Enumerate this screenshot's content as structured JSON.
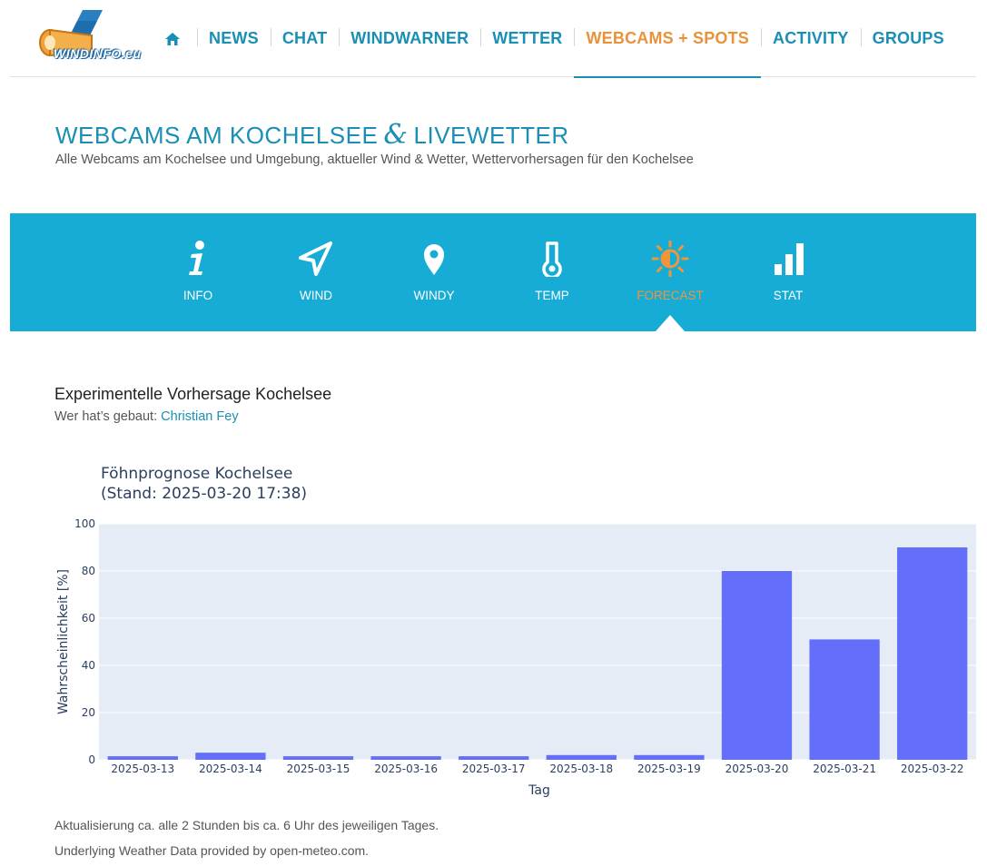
{
  "colors": {
    "brand": "#1a8fb5",
    "accent": "#e8923a",
    "band": "#17acd6",
    "bar": "#636efa",
    "plot_bg": "#e5ecf6"
  },
  "nav": {
    "home_icon": "home-icon",
    "items": [
      {
        "label": "NEWS"
      },
      {
        "label": "CHAT"
      },
      {
        "label": "WINDWARNER"
      },
      {
        "label": "WETTER"
      },
      {
        "label": "WEBCAMS + SPOTS",
        "active": true
      },
      {
        "label": "ACTIVITY"
      },
      {
        "label": "GROUPS"
      }
    ]
  },
  "logo": {
    "text": "WINDINFO.eu"
  },
  "title": {
    "part1": "WEBCAMS AM KOCHELSEE",
    "amp": "&",
    "part2": "LIVEWETTER"
  },
  "subtitle": "Alle Webcams am Kochelsee und Umgebung, aktueller Wind & Wetter, Wettervorhersagen für den Kochelsee",
  "tabs": [
    {
      "label": "INFO",
      "icon": "info-icon"
    },
    {
      "label": "WIND",
      "icon": "navigation-arrow-icon"
    },
    {
      "label": "WINDY",
      "icon": "map-pin-icon"
    },
    {
      "label": "TEMP",
      "icon": "thermometer-icon"
    },
    {
      "label": "FORECAST",
      "icon": "sun-icon",
      "active": true
    },
    {
      "label": "STAT",
      "icon": "bar-chart-icon"
    }
  ],
  "section": {
    "title": "Experimentelle Vorhersage Kochelsee",
    "credit_prefix": "Wer hat’s gebaut:",
    "credit_name": "Christian Fey"
  },
  "chart_data": {
    "type": "bar",
    "title": "Föhnprognose Kochelsee",
    "subtitle": "(Stand: 2025-03-20 17:38)",
    "xlabel": "Tag",
    "ylabel": "Wahrscheinlichkeit [%]",
    "ylim": [
      0,
      100
    ],
    "yticks": [
      0,
      20,
      40,
      60,
      80,
      100
    ],
    "categories": [
      "2025-03-13",
      "2025-03-14",
      "2025-03-15",
      "2025-03-16",
      "2025-03-17",
      "2025-03-18",
      "2025-03-19",
      "2025-03-20",
      "2025-03-21",
      "2025-03-22"
    ],
    "values": [
      1.5,
      3,
      1.5,
      1.5,
      1.5,
      2,
      2,
      80,
      51,
      90
    ],
    "grid": true
  },
  "footer": {
    "line1": "Aktualisierung ca. alle 2 Stunden bis ca. 6 Uhr des jeweiligen Tages.",
    "line2": "Underlying Weather Data provided by open-meteo.com."
  }
}
